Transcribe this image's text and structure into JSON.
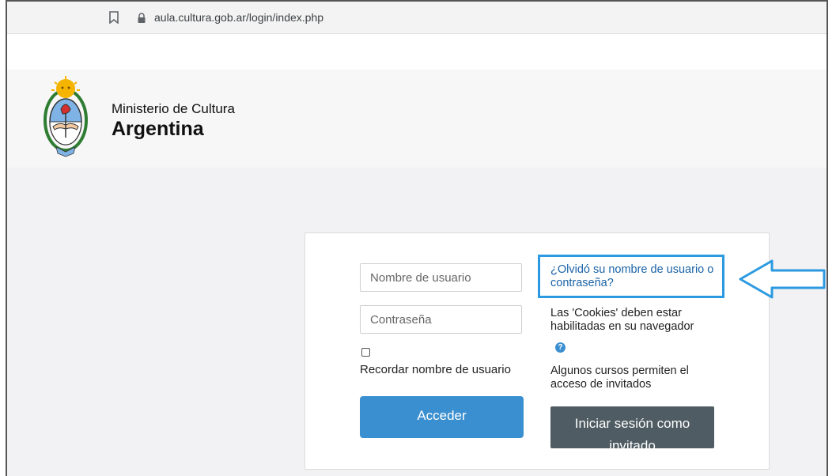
{
  "browser": {
    "url": "aula.cultura.gob.ar/login/index.php"
  },
  "header": {
    "line1": "Ministerio de Cultura",
    "line2": "Argentina"
  },
  "login": {
    "username_placeholder": "Nombre de usuario",
    "password_placeholder": "Contraseña",
    "remember_label": "Recordar nombre de usuario",
    "submit_label": "Acceder",
    "forgot_link": "¿Olvidó su nombre de usuario o contraseña?",
    "cookies_text": "Las 'Cookies' deben estar habilitadas en su navegador",
    "help_icon_glyph": "?",
    "guest_info": "Algunos cursos permiten el acceso de invitados",
    "guest_button": "Iniciar sesión como invitado"
  },
  "icons": {
    "bookmark": "bookmark-icon",
    "lock": "lock-icon",
    "help": "question-circle-icon",
    "annotation_arrow": "left-arrow-icon"
  },
  "colors": {
    "primary_button": "#3a8fd0",
    "guest_button": "#4f5c63",
    "link": "#1a63a7",
    "highlight_border": "#2c9ae0"
  }
}
